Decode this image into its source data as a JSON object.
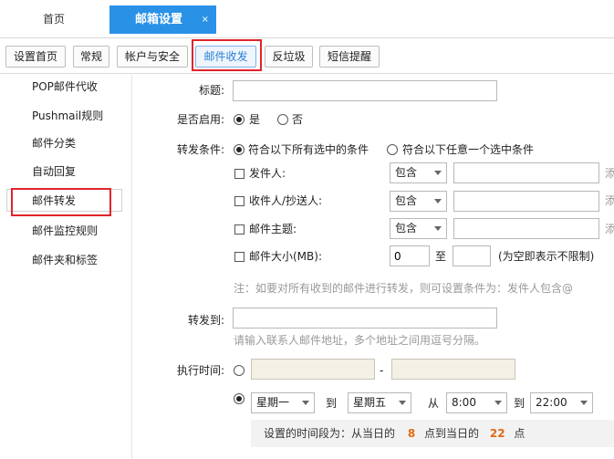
{
  "tabs": {
    "home_label": "首页",
    "active_label": "邮箱设置",
    "close_glyph": "×"
  },
  "toolbar": {
    "buttons": [
      "设置首页",
      "常规",
      "帐户与安全",
      "邮件收发",
      "反垃圾",
      "短信提醒"
    ],
    "active_index": 3
  },
  "sidebar": {
    "items": [
      "POP邮件代收",
      "Pushmail规则",
      "邮件分类",
      "自动回复",
      "邮件转发",
      "邮件监控规则",
      "邮件夹和标签"
    ],
    "selected_index": 4
  },
  "form": {
    "title_label": "标题:",
    "title_value": "",
    "enable_label": "是否启用:",
    "enable_yes": "是",
    "enable_no": "否",
    "enable_selected": "是",
    "cond_label": "转发条件:",
    "cond_all": "符合以下所有选中的条件",
    "cond_any": "符合以下任意一个选中条件",
    "cond_selected": "符合以下所有选中的条件",
    "rules": [
      {
        "label": "发件人:",
        "checked": false,
        "op": "包含",
        "value": "",
        "trail": "添"
      },
      {
        "label": "收件人/抄送人:",
        "checked": false,
        "op": "包含",
        "value": "",
        "trail": "添"
      },
      {
        "label": "邮件主题:",
        "checked": false,
        "op": "包含",
        "value": "",
        "trail": "添"
      }
    ],
    "size_label": "邮件大小(MB):",
    "size_checked": false,
    "size_from": "0",
    "size_to_word": "至",
    "size_to": "",
    "size_hint": "(为空即表示不限制)",
    "note": "注：如要对所有收到的邮件进行转发，则可设置条件为：发件人包含@",
    "forward_label": "转发到:",
    "forward_value": "",
    "forward_hint": "请输入联系人邮件地址，多个地址之间用逗号分隔。",
    "exec_label": "执行时间:",
    "exec_dash": "-",
    "exec_mode_selected": 1,
    "day_from": "星期一",
    "day_to_word": "到",
    "day_to": "星期五",
    "time_from_word": "从",
    "time_from": "8:00",
    "time_to_word": "到",
    "time_to": "22:00",
    "summary_prefix": "设置的时间段为：从当日的",
    "summary_start": "8",
    "summary_mid": "点到当日的",
    "summary_end": "22",
    "summary_suffix": "点"
  },
  "colors": {
    "accent": "#2a92e6",
    "highlight_border": "#e0242b",
    "time_number": "#e06b14"
  }
}
